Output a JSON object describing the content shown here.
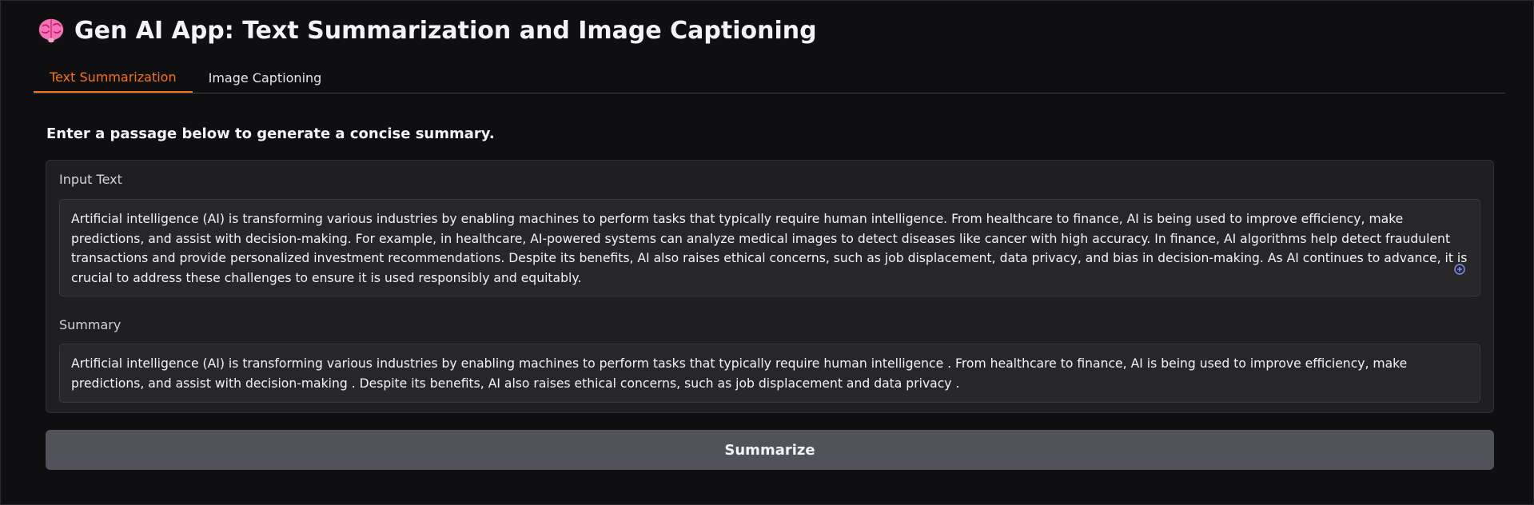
{
  "header": {
    "title": "Gen AI App: Text Summarization and Image Captioning",
    "icon": "brain-icon"
  },
  "tabs": [
    {
      "label": "Text Summarization",
      "active": true
    },
    {
      "label": "Image Captioning",
      "active": false
    }
  ],
  "main": {
    "instructions": "Enter a passage below to generate a concise summary.",
    "input": {
      "label": "Input Text",
      "value": "Artificial intelligence (AI) is transforming various industries by enabling machines to perform tasks that typically require human intelligence. From healthcare to finance, AI is being used to improve efficiency, make predictions, and assist with decision-making. For example, in healthcare, AI-powered systems can analyze medical images to detect diseases like cancer with high accuracy. In finance, AI algorithms help detect fraudulent transactions and provide personalized investment recommendations. Despite its benefits, AI also raises ethical concerns, such as job displacement, data privacy, and bias in decision-making. As AI continues to advance, it is crucial to address these challenges to ensure it is used responsibly and equitably."
    },
    "output": {
      "label": "Summary",
      "value": " Artificial intelligence (AI) is transforming various industries by enabling machines to perform tasks that typically require human intelligence . From healthcare to finance, AI is being used to improve efficiency, make predictions, and assist with decision-making . Despite its benefits, AI also raises ethical concerns, such as job displacement and data privacy ."
    },
    "submit_label": "Summarize"
  },
  "colors": {
    "accent": "#f97316",
    "background": "#0f0f11",
    "panel": "#1f1f23",
    "button": "#52525b"
  }
}
